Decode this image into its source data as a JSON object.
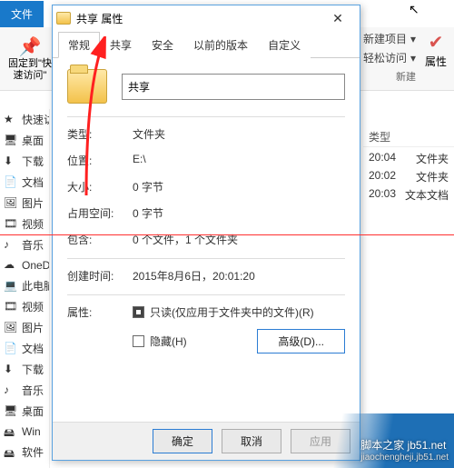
{
  "explorer": {
    "file_tab": "文件",
    "ribbon": {
      "pin_label": "固定到\"快\n速访问\"",
      "new_item": "新建项目",
      "easy_access": "轻松访问",
      "properties": "属性",
      "group_new": "新建"
    },
    "nav": [
      {
        "icon": "star",
        "label": "快速访"
      },
      {
        "icon": "desktop",
        "label": "桌面"
      },
      {
        "icon": "download",
        "label": "下载"
      },
      {
        "icon": "doc",
        "label": "文档"
      },
      {
        "icon": "picture",
        "label": "图片"
      },
      {
        "icon": "video",
        "label": "视频"
      },
      {
        "icon": "music",
        "label": "音乐"
      },
      {
        "icon": "onedrive",
        "label": "OneD"
      },
      {
        "icon": "pc",
        "label": "此电脑"
      },
      {
        "icon": "video",
        "label": "视频"
      },
      {
        "icon": "picture",
        "label": "图片"
      },
      {
        "icon": "doc",
        "label": "文档"
      },
      {
        "icon": "download",
        "label": "下载"
      },
      {
        "icon": "music",
        "label": "音乐"
      },
      {
        "icon": "desktop",
        "label": "桌面"
      },
      {
        "icon": "disk",
        "label": "Win"
      },
      {
        "icon": "disk",
        "label": "软件"
      }
    ],
    "list": {
      "header_type": "类型",
      "rows": [
        {
          "time": "20:04",
          "type": "文件夹"
        },
        {
          "time": "20:02",
          "type": "文件夹"
        },
        {
          "time": "20:03",
          "type": "文本文档"
        }
      ]
    }
  },
  "dialog": {
    "title": "共享 属性",
    "tabs": {
      "general": "常规",
      "share": "共享",
      "security": "安全",
      "prev": "以前的版本",
      "custom": "自定义"
    },
    "folder_name": "共享",
    "rows": {
      "type_k": "类型:",
      "type_v": "文件夹",
      "loc_k": "位置:",
      "loc_v": "E:\\",
      "size_k": "大小:",
      "size_v": "0 字节",
      "ondisk_k": "占用空间:",
      "ondisk_v": "0 字节",
      "contains_k": "包含:",
      "contains_v": "0 个文件，1 个文件夹",
      "created_k": "创建时间:",
      "created_v": "2015年8月6日，20:01:20",
      "attr_k": "属性:",
      "readonly": "只读(仅应用于文件夹中的文件)(R)",
      "hidden": "隐藏(H)",
      "advanced": "高级(D)..."
    },
    "buttons": {
      "ok": "确定",
      "cancel": "取消",
      "apply": "应用"
    }
  },
  "watermark": {
    "main": "脚本之家 jb51.net",
    "sub": "jiaochengheji.jb51.net"
  }
}
